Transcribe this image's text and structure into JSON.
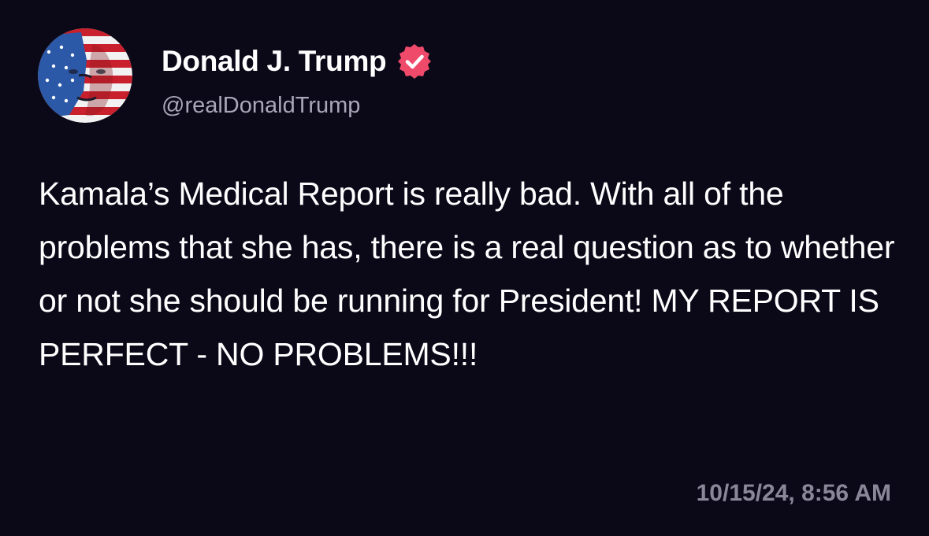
{
  "author": {
    "name": "Donald J. Trump",
    "handle": "@realDonaldTrump",
    "verified_badge_icon": "verified-check-icon",
    "verified_color": "#f04a6b"
  },
  "post": {
    "text": "Kamala’s Medical Report is really bad. With all of the problems that she has, there is a real question as to whether or not she should be running for President! MY REPORT IS PERFECT - NO PROBLEMS!!!",
    "timestamp": "10/15/24, 8:56 AM"
  },
  "colors": {
    "background": "#0b0918",
    "handle": "#a9a6b8",
    "timestamp": "#8a8799"
  }
}
